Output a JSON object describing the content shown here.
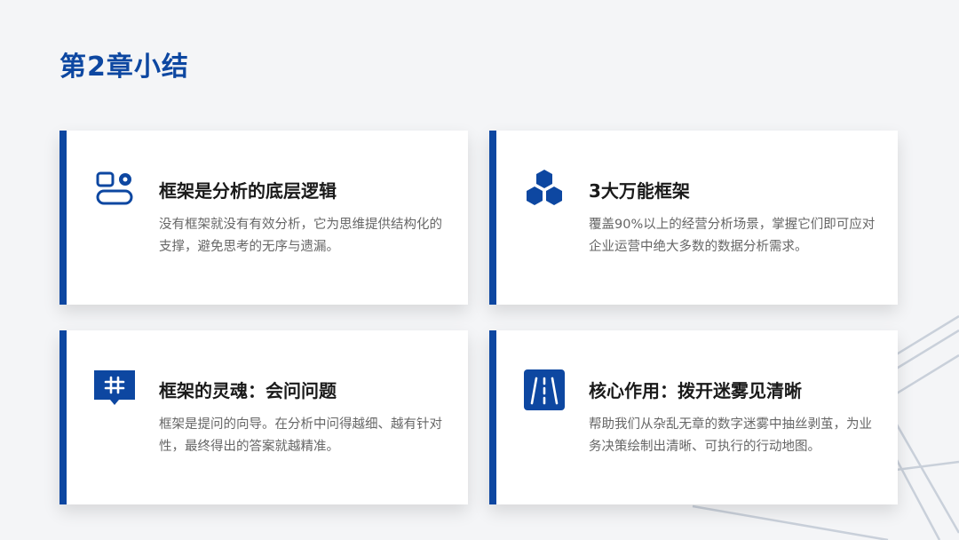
{
  "page": {
    "title": "第2章小结"
  },
  "colors": {
    "accent": "#0d47a1",
    "background": "#f4f5f7",
    "card": "#ffffff",
    "title_text": "#1a1a1a",
    "desc_text": "#666666"
  },
  "cards": [
    {
      "icon": "toggle-settings-icon",
      "title": "框架是分析的底层逻辑",
      "description": "没有框架就没有有效分析，它为思维提供结构化的支撑，避免思考的无序与遗漏。"
    },
    {
      "icon": "hexagon-cluster-icon",
      "title": "3大万能框架",
      "description": "覆盖90%以上的经营分析场景，掌握它们即可应对企业运营中绝大多数的数据分析需求。"
    },
    {
      "icon": "hashtag-chat-icon",
      "title": "框架的灵魂：会问问题",
      "description": "框架是提问的向导。在分析中问得越细、越有针对性，最终得出的答案就越精准。"
    },
    {
      "icon": "road-icon",
      "title": "核心作用：拨开迷雾见清晰",
      "description": "帮助我们从杂乱无章的数字迷雾中抽丝剥茧，为业务决策绘制出清晰、可执行的行动地图。"
    }
  ]
}
